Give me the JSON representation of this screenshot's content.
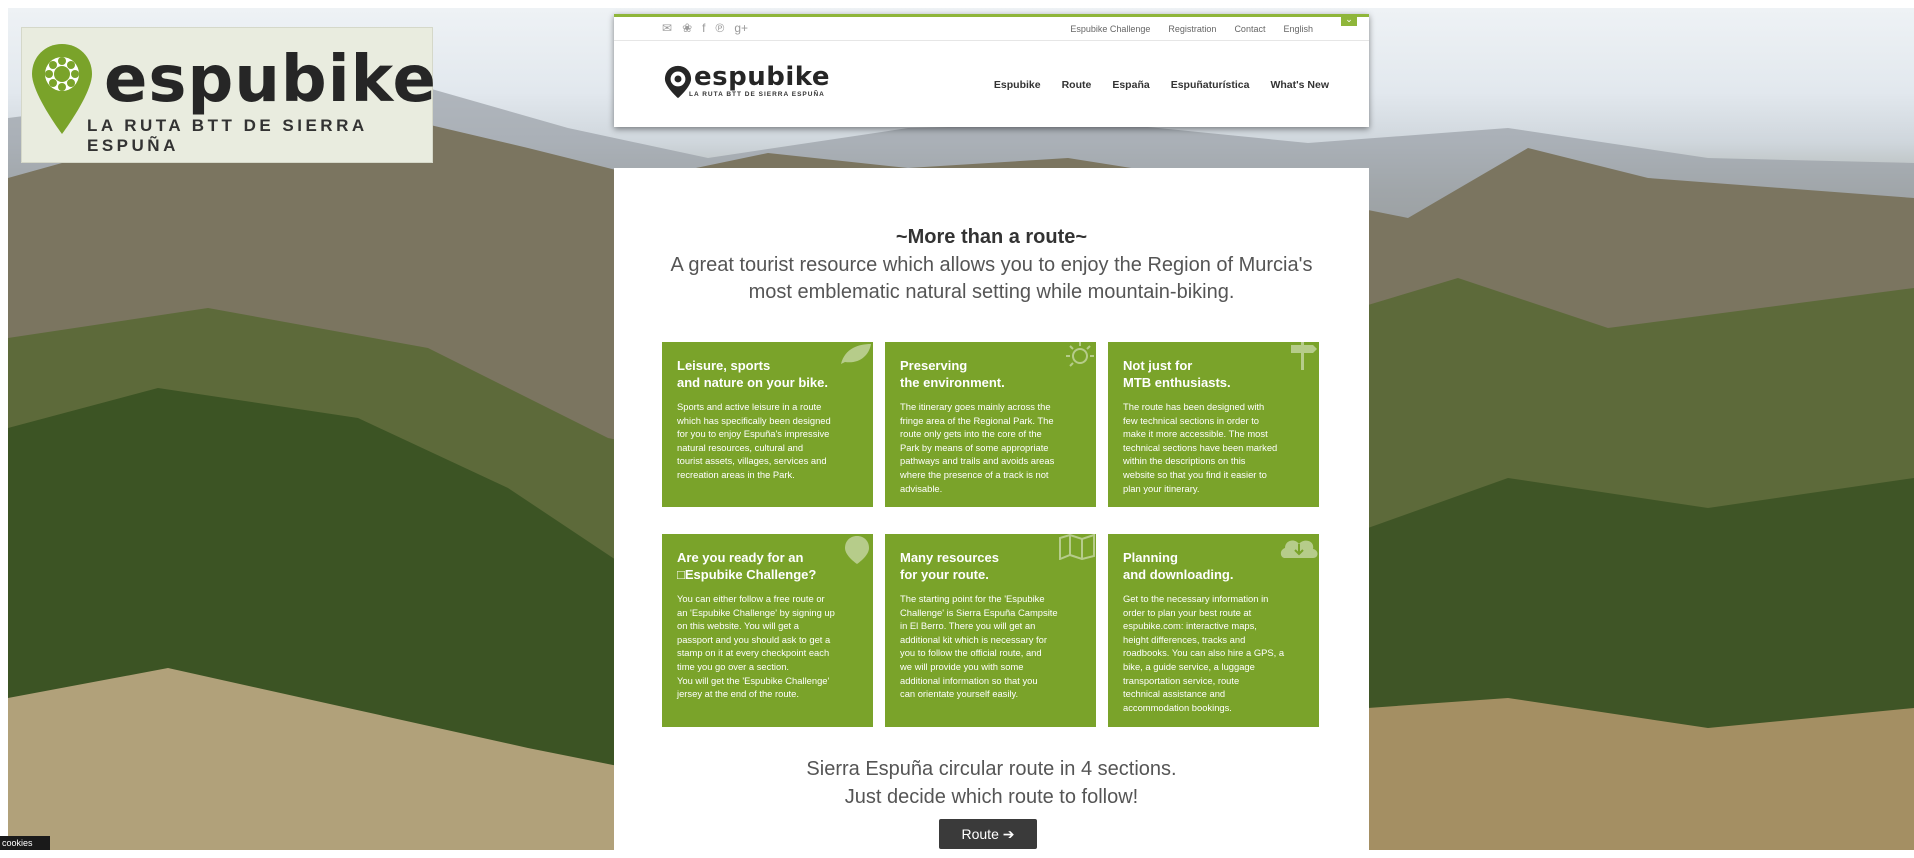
{
  "brand": {
    "name": "espubike",
    "tagline": "LA RUTA BTT DE SIERRA ESPUÑA",
    "accent_color": "#7aa32a"
  },
  "topbar": {
    "social_icons": [
      "mail-icon",
      "twitter-icon",
      "facebook-icon",
      "pinterest-icon",
      "googleplus-icon"
    ],
    "links": [
      "Espubike Challenge",
      "Registration",
      "Contact",
      "English"
    ]
  },
  "nav": {
    "items": [
      "Espubike",
      "Route",
      "España",
      "Espuñaturística",
      "What's New"
    ]
  },
  "main": {
    "headline": "~More than a route~",
    "subheadline": "A great tourist resource which allows you to enjoy the Region of Murcia's most emblematic natural setting while mountain-biking.",
    "cards": [
      {
        "title": "Leisure, sports\nand nature on your bike.",
        "text": "Sports and active leisure in a route\nwhich has specifically been designed\nfor you to enjoy Espuña's impressive\nnatural resources, cultural and\ntourist assets, villages, services and\nrecreation areas in the Park.",
        "icon": "leaf-icon"
      },
      {
        "title": "Preserving\nthe environment.",
        "text": "The itinerary goes mainly across the\nfringe area of the Regional Park. The\nroute only gets into the core of the\nPark by means of some appropriate\npathways and trails and avoids areas\nwhere the presence of a track is not\nadvisable.",
        "icon": "sun-icon"
      },
      {
        "title": "Not just for\nMTB enthusiasts.",
        "text": "The route has been designed with\nfew technical sections in order to\nmake it more accessible. The most\ntechnical sections have been marked\nwithin the descriptions on this\nwebsite so that you find it easier to\nplan your itinerary.",
        "icon": "signpost-icon"
      },
      {
        "title": "Are you ready for an\n□Espubike Challenge?",
        "text": "You can either follow a free route or\nan 'Espubike Challenge' by signing up\non this website. You will get a\npassport and you should ask to get a\nstamp on it at every checkpoint each\ntime you go over a section.\nYou will get the 'Espubike Challenge'\njersey at the end of the route.",
        "icon": "map-pin-icon"
      },
      {
        "title": "Many resources\nfor your route.",
        "text": "The starting point for the 'Espubike\nChallenge' is Sierra Espuña Campsite\nin El Berro. There you will get an\nadditional kit which is necessary for\nyou to follow the official route, and\nwe will provide you with some\nadditional information so that you\ncan orientate yourself easily.",
        "icon": "map-icon"
      },
      {
        "title": "Planning\nand downloading.",
        "text": "Get to the necessary information in\norder to plan your best route at\nespubike.com: interactive maps,\nheight differences, tracks and\nroadbooks. You can also hire a GPS, a\nbike, a guide service, a luggage\ntransportation service, route\ntechnical assistance and\naccommodation bookings.",
        "icon": "download-cloud-icon"
      }
    ],
    "bottom_line1": "Sierra Espuña circular route in 4 sections.",
    "bottom_line2": "Just decide which route to follow!",
    "route_button": "Route ➔"
  },
  "cookies_label": "cookies"
}
